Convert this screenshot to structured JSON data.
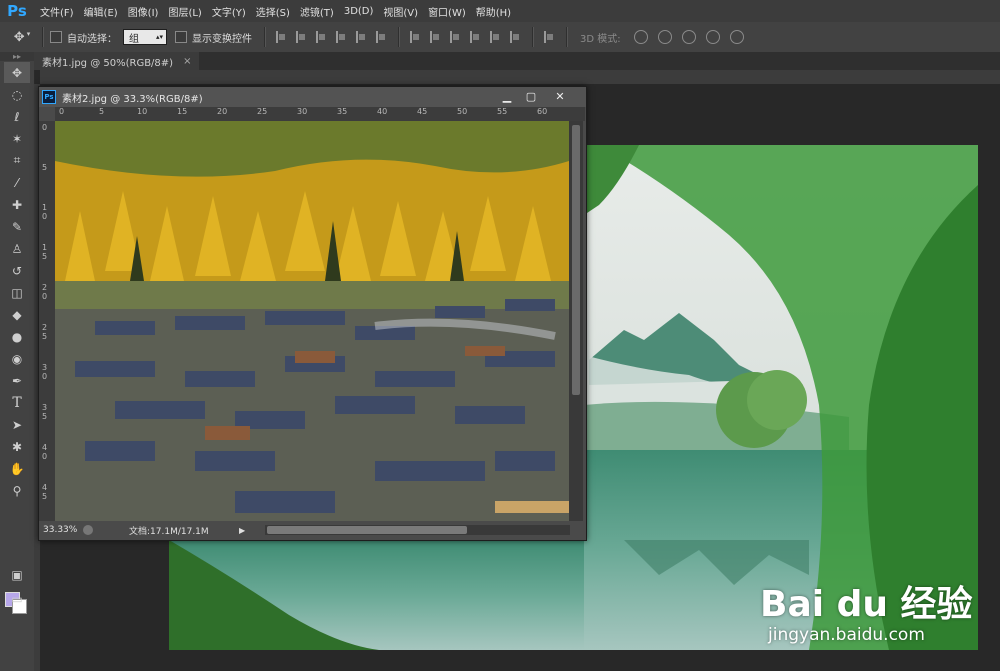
{
  "app": {
    "logo": "Ps"
  },
  "menu": [
    "文件(F)",
    "编辑(E)",
    "图像(I)",
    "图层(L)",
    "文字(Y)",
    "选择(S)",
    "滤镜(T)",
    "3D(D)",
    "视图(V)",
    "窗口(W)",
    "帮助(H)"
  ],
  "options": {
    "auto_select_label": "自动选择：",
    "auto_select_value": "组",
    "show_transform_label": "显示变换控件",
    "mode_3d_label": "3D 模式:"
  },
  "doc_tab": {
    "title": "素材1.jpg @ 50%(RGB/8#)",
    "close": "×"
  },
  "float_window": {
    "title": "素材2.jpg @ 33.3%(RGB/8#)",
    "zoom": "33.33%",
    "doc_info": "文档:17.1M/17.1M",
    "ruler_h": [
      "0",
      "5",
      "10",
      "15",
      "20",
      "25",
      "30",
      "35",
      "40",
      "45",
      "50",
      "55",
      "60"
    ],
    "ruler_v": [
      "0",
      "5",
      "1 0",
      "1 5",
      "2 0",
      "2 5",
      "3 0",
      "3 5",
      "4 0",
      "4 5"
    ]
  },
  "watermark": {
    "logo": "Bai du 经验",
    "url": "jingyan.baidu.com"
  },
  "colors": {
    "foreground": "#b7a7ea",
    "background": "#ffffff",
    "ps_blue": "#31a8ff"
  },
  "tools": [
    "move-icon",
    "marquee-icon",
    "lasso-icon",
    "magic-wand-icon",
    "crop-icon",
    "eyedropper-icon",
    "healing-icon",
    "brush-icon",
    "stamp-icon",
    "history-brush-icon",
    "eraser-icon",
    "gradient-icon",
    "blur-icon",
    "dodge-icon",
    "pen-icon",
    "type-icon",
    "path-select-icon",
    "shape-icon",
    "hand-icon",
    "zoom-icon"
  ]
}
